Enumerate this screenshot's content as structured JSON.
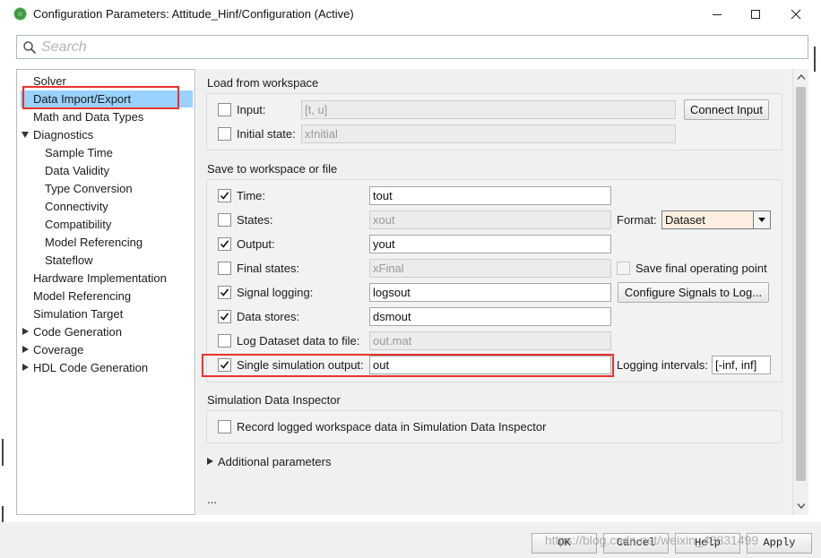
{
  "window": {
    "title": "Configuration Parameters: Attitude_Hinf/Configuration (Active)",
    "buttons": {
      "minimize": "—",
      "maximize": "☐",
      "close": "✕"
    }
  },
  "search": {
    "placeholder": "Search",
    "value": ""
  },
  "sidebar": {
    "items": [
      {
        "label": "Solver"
      },
      {
        "label": "Data Import/Export",
        "selected": true
      },
      {
        "label": "Math and Data Types"
      },
      {
        "label": "Diagnostics",
        "expander": "expanded"
      },
      {
        "label": "Sample Time"
      },
      {
        "label": "Data Validity"
      },
      {
        "label": "Type Conversion"
      },
      {
        "label": "Connectivity"
      },
      {
        "label": "Compatibility"
      },
      {
        "label": "Model Referencing"
      },
      {
        "label": "Stateflow"
      },
      {
        "label": "Hardware Implementation"
      },
      {
        "label": "Model Referencing"
      },
      {
        "label": "Simulation Target"
      },
      {
        "label": "Code Generation",
        "expander": "collapsed"
      },
      {
        "label": "Coverage",
        "expander": "collapsed"
      },
      {
        "label": "HDL Code Generation",
        "expander": "collapsed"
      }
    ]
  },
  "load": {
    "title": "Load from workspace",
    "input": {
      "label": "Input:",
      "value": "[t, u]",
      "checked": false
    },
    "initial_state": {
      "label": "Initial state:",
      "value": "xInitial",
      "checked": false
    },
    "connect_input_button": "Connect Input"
  },
  "save": {
    "title": "Save to workspace or file",
    "time": {
      "label": "Time:",
      "value": "tout",
      "checked": true
    },
    "states": {
      "label": "States:",
      "value": "xout",
      "checked": false
    },
    "format": {
      "label": "Format:",
      "value": "Dataset"
    },
    "output": {
      "label": "Output:",
      "value": "yout",
      "checked": true
    },
    "final_states": {
      "label": "Final states:",
      "value": "xFinal",
      "checked": false
    },
    "save_final_op": {
      "label": "Save final operating point",
      "checked": false
    },
    "signal_logging": {
      "label": "Signal logging:",
      "value": "logsout",
      "checked": true
    },
    "configure_signals_button": "Configure Signals to Log...",
    "data_stores": {
      "label": "Data stores:",
      "value": "dsmout",
      "checked": true
    },
    "log_dataset": {
      "label": "Log Dataset data to file:",
      "value": "out.mat",
      "checked": false
    },
    "single_output": {
      "label": "Single simulation output:",
      "value": "out",
      "checked": true
    },
    "logging_intervals": {
      "label": "Logging intervals:",
      "value": "[-inf, inf]"
    }
  },
  "sdi": {
    "title": "Simulation Data Inspector",
    "record": {
      "label": "Record logged workspace data in Simulation Data Inspector",
      "checked": false
    }
  },
  "additional_parameters": "Additional parameters",
  "ellipsis": "...",
  "footer": {
    "ok": "OK",
    "cancel": "Cancel",
    "help": "Help",
    "apply": "Apply"
  },
  "watermark": "https://blog.csdn.net/weixin_43831499",
  "colors": {
    "selection": "#99d1ff",
    "highlight_box": "#e8322c",
    "dropdown_bg": "#fdf0e2"
  }
}
